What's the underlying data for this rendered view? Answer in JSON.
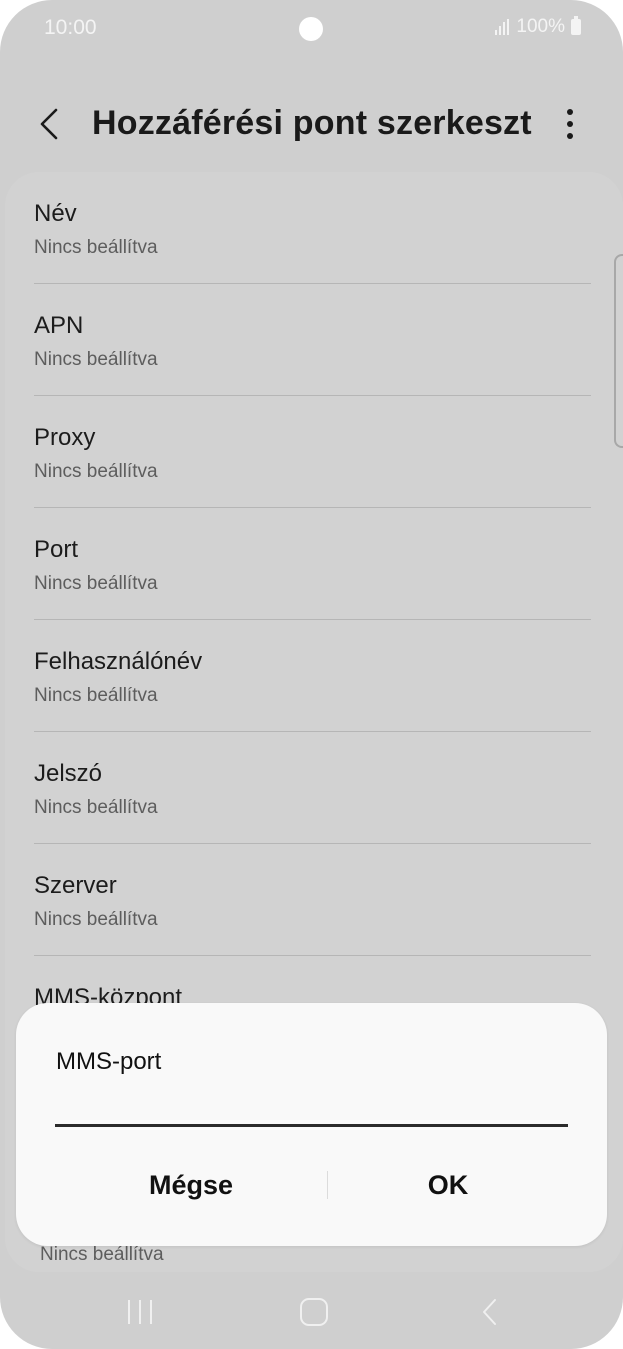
{
  "status_bar": {
    "time": "10:00",
    "battery": "100%",
    "icons": [
      "camera-dot",
      "signal-icon",
      "battery-icon"
    ]
  },
  "header": {
    "title": "Hozzáférési pont szerkeszt...",
    "back_icon": "chevron-left-icon",
    "more_icon": "more-vertical-icon"
  },
  "list": {
    "items": [
      {
        "label": "Név",
        "value": "Nincs beállítva"
      },
      {
        "label": "APN",
        "value": "Nincs beállítva"
      },
      {
        "label": "Proxy",
        "value": "Nincs beállítva"
      },
      {
        "label": "Port",
        "value": "Nincs beállítva"
      },
      {
        "label": "Felhasználónév",
        "value": "Nincs beállítva"
      },
      {
        "label": "Jelszó",
        "value": "Nincs beállítva"
      },
      {
        "label": "Szerver",
        "value": "Nincs beállítva"
      },
      {
        "label": "MMS-központ",
        "value": ""
      }
    ],
    "bottom_value": "Nincs beállítva"
  },
  "dialog": {
    "title": "MMS-port",
    "input_value": "",
    "cancel_label": "Mégse",
    "ok_label": "OK"
  },
  "nav_bar": {
    "icons": [
      "recents-icon",
      "home-icon",
      "back-icon"
    ]
  },
  "colors": {
    "dimmed_background": "#cfcfcf",
    "dialog_background": "#f9f9f9",
    "text_primary": "#1c1c1c",
    "text_secondary": "#5d5d5d"
  }
}
